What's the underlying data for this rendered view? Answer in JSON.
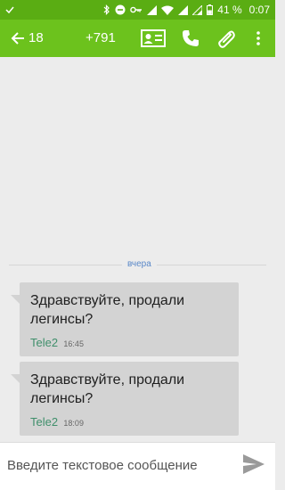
{
  "status_bar": {
    "battery_percent": "41 %",
    "clock": "0:07",
    "icons": [
      "check-icon",
      "bluetooth-icon",
      "do-not-disturb-icon",
      "key-icon",
      "wifi-icon",
      "signal-icon",
      "signal-icon",
      "battery-icon"
    ]
  },
  "toolbar": {
    "title_part1": "18",
    "title_part2": "+791",
    "icons": [
      "back-arrow-icon",
      "contact-card-icon",
      "phone-icon",
      "paperclip-icon",
      "more-vert-icon"
    ],
    "color": "#6cc21d",
    "status_color": "#5aad13"
  },
  "conversation": {
    "date_divider": "вчера",
    "messages": [
      {
        "text": "Здравствуйте, продали легинсы?",
        "sender": "Tele2",
        "time": "16:45"
      },
      {
        "text": "Здравствуйте, продали легинсы?",
        "sender": "Tele2",
        "time": "18:09"
      }
    ]
  },
  "composer": {
    "placeholder": "Введите текстовое сообщение",
    "send_icon": "send-icon"
  }
}
